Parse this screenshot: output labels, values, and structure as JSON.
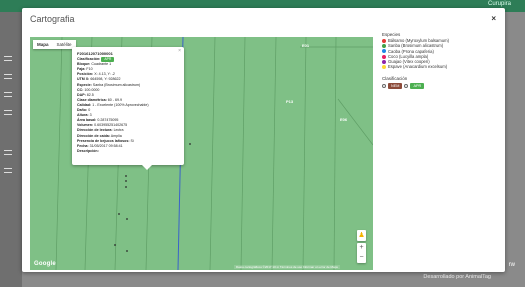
{
  "background": {
    "user_label": "Curupira",
    "footer_text": "Desarrollado por AnimalTag",
    "partial_text": "rw"
  },
  "modal": {
    "title": "Cartografia",
    "close_label": "×"
  },
  "map": {
    "tabs": [
      "Mapa",
      "Satélite"
    ],
    "parcel_labels": [
      "E01",
      "P13",
      "E06"
    ],
    "logo": "Google",
    "attribution": "Datos cartográficos ©2017   10 m  Términos de uso   Informar un error de Maps",
    "zoom_in": "+",
    "zoom_out": "−"
  },
  "info": {
    "id": "F201612071000001",
    "clasificacion_label": "Clasificación:",
    "clasificacion_value": "APR",
    "rows": [
      {
        "k": "Bloque:",
        "v": "Cuadrante 1"
      },
      {
        "k": "Faja:",
        "v": "F10"
      },
      {
        "k": "Posición:",
        "v": "X: 4.13, Y: -2"
      },
      {
        "k": "UTM X:",
        "v": "664598, Y: 928622"
      },
      {
        "k": "Especie:",
        "v": "Sanba (Brosimum alicastrum)"
      },
      {
        "k": "CC:",
        "v": "100.0000"
      },
      {
        "k": "DAP:",
        "v": "82.5"
      },
      {
        "k": "Clase diamétrica:",
        "v": "60 - 69.9"
      },
      {
        "k": "Calidad:",
        "v": "1 - Excelente (100% Aprovechable)"
      },
      {
        "k": "Daño:",
        "v": "0"
      },
      {
        "k": "Altura:",
        "v": "3"
      },
      {
        "k": "Área basal:",
        "v": "0.287475095"
      },
      {
        "k": "Volumen:",
        "v": "0.603955251402675"
      },
      {
        "k": "Dirección de lectura:",
        "v": "Lectra"
      },
      {
        "k": "Dirección de caída:",
        "v": "Amplia"
      },
      {
        "k": "Presencia de bejucos lañosos:",
        "v": "Si"
      },
      {
        "k": "Fecha:",
        "v": "31/05/2017 09:58:41"
      },
      {
        "k": "Descripción:",
        "v": ""
      }
    ]
  },
  "legend": {
    "title": "Especies",
    "items": [
      {
        "label": "Bálsamo (Myroxylum balsamum)",
        "color": "#e53935"
      },
      {
        "label": "Sanba (Brosimum alicastrum)",
        "color": "#43a047"
      },
      {
        "label": "Caoba (Prona capaferia)",
        "color": "#1e88e5"
      },
      {
        "label": "Coco (Lucyilla ampla)",
        "color": "#e91e63"
      },
      {
        "label": "Guajao (Vitex cooperi)",
        "color": "#8e24aa"
      },
      {
        "label": "Espave (Anacardium excelsum)",
        "color": "#fdd835"
      }
    ],
    "clasificacion_title": "Clasificación",
    "buttons": [
      {
        "label": "NEM",
        "color": "#8d4b3a"
      },
      {
        "label": "APR",
        "color": "#4caf50"
      }
    ]
  }
}
